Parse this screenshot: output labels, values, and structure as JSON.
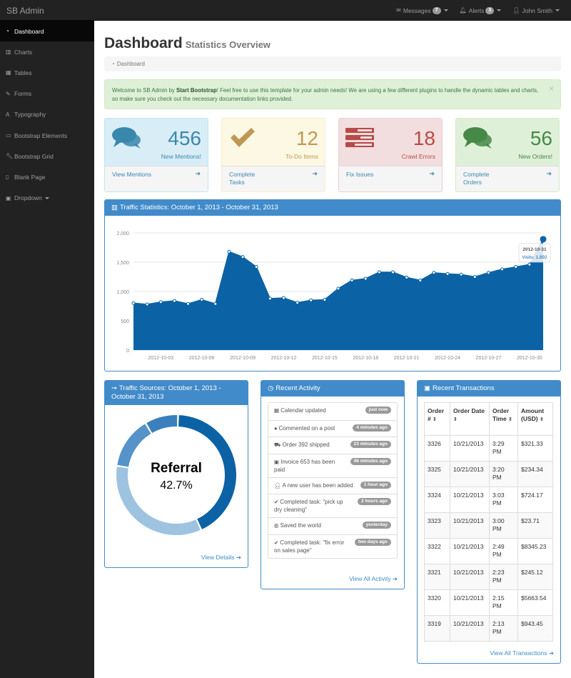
{
  "navbar": {
    "brand": "SB Admin",
    "messages_label": "Messages",
    "messages_count": "7",
    "alerts_label": "Alerts",
    "alerts_count": "3",
    "user_name": "John Smith"
  },
  "sidebar": {
    "items": [
      {
        "label": "Dashboard",
        "icon": "dashboard-icon"
      },
      {
        "label": "Charts",
        "icon": "bar-chart-icon"
      },
      {
        "label": "Tables",
        "icon": "table-icon"
      },
      {
        "label": "Forms",
        "icon": "edit-icon"
      },
      {
        "label": "Typography",
        "icon": "font-icon"
      },
      {
        "label": "Bootstrap Elements",
        "icon": "desktop-icon"
      },
      {
        "label": "Bootstrap Grid",
        "icon": "wrench-icon"
      },
      {
        "label": "Blank Page",
        "icon": "file-icon"
      },
      {
        "label": "Dropdown",
        "icon": "caret-square-icon"
      }
    ]
  },
  "page": {
    "title": "Dashboard",
    "subtitle": "Statistics Overview",
    "breadcrumb": "Dashboard"
  },
  "alert": {
    "text_before": "Welcome to SB Admin by ",
    "text_bold": "Start Bootstrap",
    "text_after": "! Feel free to use this template for your admin needs! We are using a few different plugins to handle the dynamic tables and charts, so make sure you check out the necessary documentation links provided."
  },
  "stats": [
    {
      "value": "456",
      "label": "New Mentions!",
      "link_line1": "View Mentions",
      "link_line2": "",
      "icon": "comments-icon"
    },
    {
      "value": "12",
      "label": "To-Do Items",
      "link_line1": "Complete",
      "link_line2": "Tasks",
      "icon": "check-icon"
    },
    {
      "value": "18",
      "label": "Crawl Errors",
      "link_line1": "Fix Issues",
      "link_line2": "",
      "icon": "tasks-icon"
    },
    {
      "value": "56",
      "label": "New Orders!",
      "link_line1": "Complete",
      "link_line2": "Orders",
      "icon": "comments-icon"
    }
  ],
  "traffic_panel": {
    "title": "Traffic Statistics: October 1, 2013 - October 31, 2013",
    "tooltip_date": "2012-10-31",
    "tooltip_visits": "Visits: 1,892"
  },
  "chart_data": [
    {
      "type": "area",
      "x": [
        "2012-10-01",
        "2012-10-02",
        "2012-10-03",
        "2012-10-04",
        "2012-10-05",
        "2012-10-06",
        "2012-10-07",
        "2012-10-08",
        "2012-10-09",
        "2012-10-10",
        "2012-10-11",
        "2012-10-12",
        "2012-10-13",
        "2012-10-14",
        "2012-10-15",
        "2012-10-16",
        "2012-10-17",
        "2012-10-18",
        "2012-10-19",
        "2012-10-20",
        "2012-10-21",
        "2012-10-22",
        "2012-10-23",
        "2012-10-24",
        "2012-10-25",
        "2012-10-26",
        "2012-10-27",
        "2012-10-28",
        "2012-10-29",
        "2012-10-30",
        "2012-10-31"
      ],
      "values": [
        802,
        780,
        820,
        840,
        790,
        860,
        790,
        1680,
        1590,
        1420,
        880,
        890,
        810,
        850,
        860,
        1050,
        1190,
        1220,
        1330,
        1330,
        1240,
        1190,
        1320,
        1300,
        1290,
        1250,
        1320,
        1380,
        1420,
        1460,
        1892
      ],
      "x_ticks": [
        "2012-10-03",
        "2012-10-06",
        "2012-10-09",
        "2012-10-12",
        "2012-10-15",
        "2012-10-18",
        "2012-10-21",
        "2012-10-24",
        "2012-10-27",
        "2012-10-30"
      ],
      "y_ticks": [
        "0",
        "500",
        "1,000",
        "1,500",
        "2,000"
      ],
      "ylim": [
        0,
        2000
      ],
      "grid": true,
      "color": "#0b62a4"
    },
    {
      "type": "pie",
      "donut": true,
      "segments": [
        {
          "label": "Referral",
          "value": 42.7,
          "color": "#0b62a4"
        },
        {
          "label": "",
          "value": 34.3,
          "color": "#9ec3e1"
        },
        {
          "label": "",
          "value": 14.0,
          "color": "#5593c8"
        },
        {
          "label": "",
          "value": 9.0,
          "color": "#3a80bd"
        }
      ],
      "center_label": "Referral",
      "center_value": "42.7%"
    }
  ],
  "sources_panel": {
    "title": "Traffic Sources: October 1, 2013 - October 31, 2013",
    "link": "View Details"
  },
  "activity_panel": {
    "title": "Recent Activity",
    "link": "View All Activity",
    "items": [
      {
        "text": "Calendar updated",
        "time": "just now",
        "icon": "calendar-icon"
      },
      {
        "text": "Commented on a post",
        "time": "4 minutes ago",
        "icon": "comment-icon"
      },
      {
        "text": "Order 392 shipped",
        "time": "23 minutes ago",
        "icon": "truck-icon"
      },
      {
        "text": "Invoice 653 has been paid",
        "time": "46 minutes ago",
        "icon": "money-icon"
      },
      {
        "text": "A new user has been added",
        "time": "1 hour ago",
        "icon": "user-icon"
      },
      {
        "text": "Completed task: \"pick up dry cleaning\"",
        "time": "2 hours ago",
        "icon": "check-icon"
      },
      {
        "text": "Saved the world",
        "time": "yesterday",
        "icon": "globe-icon"
      },
      {
        "text": "Completed task: \"fix error on sales page\"",
        "time": "two days ago",
        "icon": "check-icon"
      }
    ]
  },
  "transactions_panel": {
    "title": "Recent Transactions",
    "link": "View All Transactions",
    "headers": [
      "Order #",
      "Order Date",
      "Order Time",
      "Amount (USD)"
    ],
    "rows": [
      [
        "3326",
        "10/21/2013",
        "3:29 PM",
        "$321.33"
      ],
      [
        "3325",
        "10/21/2013",
        "3:20 PM",
        "$234.34"
      ],
      [
        "3324",
        "10/21/2013",
        "3:03 PM",
        "$724.17"
      ],
      [
        "3323",
        "10/21/2013",
        "3:00 PM",
        "$23.71"
      ],
      [
        "3322",
        "10/21/2013",
        "2:49 PM",
        "$8345.23"
      ],
      [
        "3321",
        "10/21/2013",
        "2:23 PM",
        "$245.12"
      ],
      [
        "3320",
        "10/21/2013",
        "2:15 PM",
        "$5663.54"
      ],
      [
        "3319",
        "10/21/2013",
        "2:13 PM",
        "$943.45"
      ]
    ]
  }
}
